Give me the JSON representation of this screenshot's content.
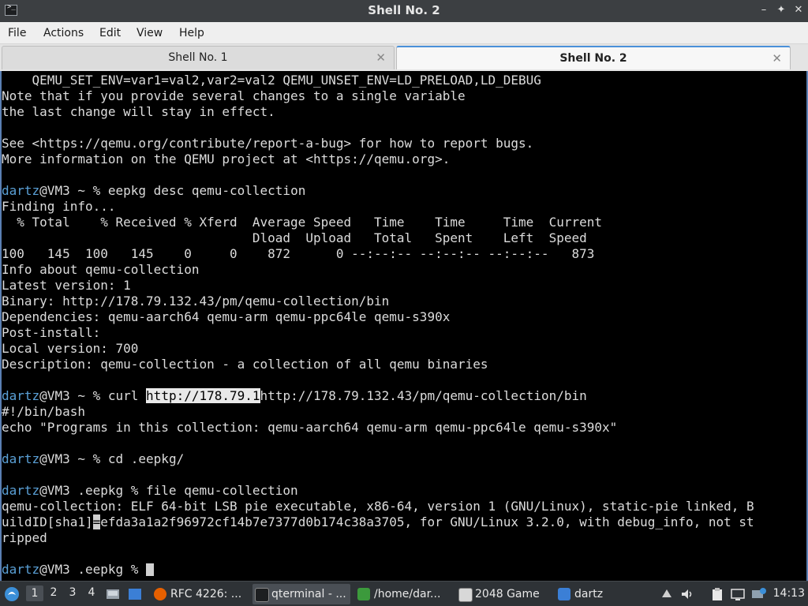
{
  "window": {
    "title": "Shell No. 2",
    "controls": {
      "minimize": "–",
      "maximize": "✦",
      "close": "✕"
    }
  },
  "menu": [
    "File",
    "Actions",
    "Edit",
    "View",
    "Help"
  ],
  "tabs": [
    {
      "label": "Shell No. 1",
      "active": false
    },
    {
      "label": "Shell No. 2",
      "active": true
    }
  ],
  "terminal": {
    "lines": [
      "    QEMU_SET_ENV=var1=val2,var2=val2 QEMU_UNSET_ENV=LD_PRELOAD,LD_DEBUG",
      "Note that if you provide several changes to a single variable",
      "the last change will stay in effect.",
      "",
      "See <https://qemu.org/contribute/report-a-bug> for how to report bugs.",
      "More information on the QEMU project at <https://qemu.org>.",
      "",
      "",
      "Finding info...",
      "  % Total    % Received % Xferd  Average Speed   Time    Time     Time  Current",
      "                                 Dload  Upload   Total   Spent    Left  Speed",
      "100   145  100   145    0     0    872      0 --:--:-- --:--:-- --:--:--   873",
      "Info about qemu-collection",
      "Latest version: 1",
      "Binary: http://178.79.132.43/pm/qemu-collection/bin",
      "Dependencies: qemu-aarch64 qemu-arm qemu-ppc64le qemu-s390x",
      "Post-install:",
      "Local version: 700",
      "Description: qemu-collection - a collection of all qemu binaries",
      "",
      "",
      "#!/bin/bash",
      "echo \"Programs in this collection: qemu-aarch64 qemu-arm qemu-ppc64le qemu-s390x\"",
      "",
      "",
      "",
      "",
      "qemu-collection: ELF 64-bit LSB pie executable, x86-64, version 1 (GNU/Linux), static-pie linked, B",
      "",
      "ripped",
      "",
      ""
    ],
    "prompt_user": "dartz",
    "cmd1": {
      "host": "@VM3 ~ % ",
      "command": "eepkg desc qemu-collection"
    },
    "cmd2": {
      "host": "@VM3 ~ % ",
      "cmd_prefix": "curl ",
      "selected": "http://178.79.1",
      "cmd_suffix": "http://178.79.132.43/pm/qemu-collection/bin"
    },
    "cmd3": {
      "host": "@VM3 ~ % ",
      "command": "cd .eepkg/"
    },
    "cmd4": {
      "host": "@VM3 .eepkg % ",
      "command": "file qemu-collection"
    },
    "buildid": {
      "prefix": "uildID[sha1]",
      "cursor_char": "=",
      "suffix": "efda3a1a2f96972cf14b7e7377d0b174c38a3705, for GNU/Linux 3.2.0, with debug_info, not st"
    },
    "cmd5": {
      "host": "@VM3 .eepkg % ",
      "command": ""
    }
  },
  "taskbar": {
    "workspaces": [
      "1",
      "2",
      "3",
      "4"
    ],
    "active_workspace": "1",
    "tasks": [
      {
        "label": "RFC 4226: ...",
        "icon": "firefox-icon",
        "color": "#e66000"
      },
      {
        "label": "qterminal - ...",
        "icon": "terminal-icon",
        "color": "#1d1f21",
        "active": true
      },
      {
        "label": "/home/dar...",
        "icon": "editor-icon",
        "color": "#3c9a3c"
      },
      {
        "label": "2048 Game",
        "icon": "window-icon",
        "color": "#d8d8d8"
      },
      {
        "label": "dartz",
        "icon": "folder-icon",
        "color": "#3b7fd6"
      }
    ],
    "clock": "14:13"
  }
}
